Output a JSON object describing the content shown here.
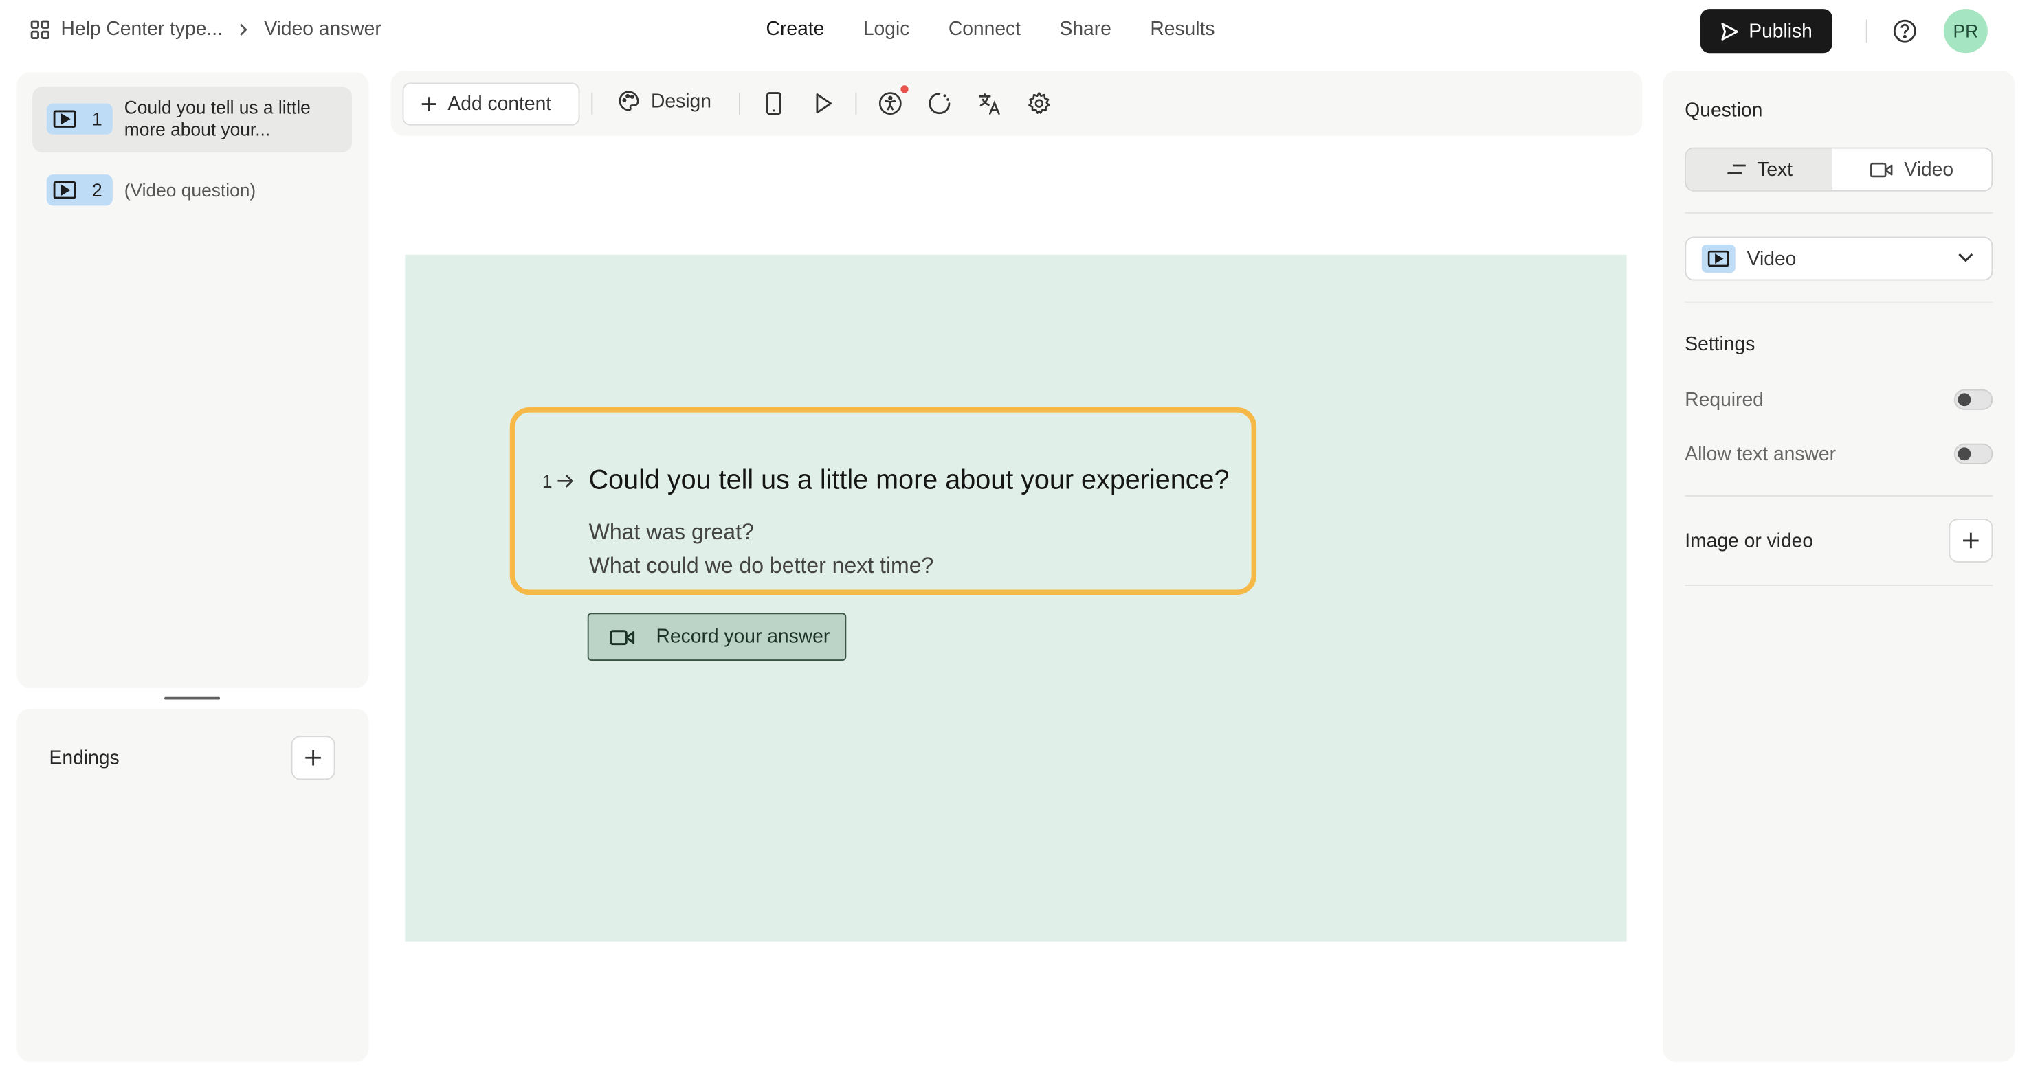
{
  "breadcrumb": {
    "form_name": "Help Center type...",
    "page": "Video answer"
  },
  "nav": {
    "create": "Create",
    "logic": "Logic",
    "connect": "Connect",
    "share": "Share",
    "results": "Results"
  },
  "header": {
    "publish_label": "Publish",
    "avatar_initials": "PR"
  },
  "questions": [
    {
      "number": "1",
      "label_line1": "Could you tell us a little",
      "label_line2": "more about your..."
    },
    {
      "number": "2",
      "label": "(Video question)"
    }
  ],
  "endings": {
    "title": "Endings"
  },
  "toolbar": {
    "add_content": "Add content",
    "design": "Design"
  },
  "canvas": {
    "question_number": "1",
    "question_title": "Could you tell us a little more about your experience?",
    "description_line1": "What was great?",
    "description_line2": "What could we do better next time?",
    "record_button": "Record your answer",
    "background_color": "#e0efe8",
    "highlight_color": "#f6b948"
  },
  "right_panel": {
    "question_title": "Question",
    "segment_text": "Text",
    "segment_video": "Video",
    "question_type": "Video",
    "settings_title": "Settings",
    "required_label": "Required",
    "allow_text_label": "Allow text answer",
    "media_title": "Image or video"
  },
  "colors": {
    "badge_blue": "#bfdcf7",
    "avatar_green": "#a6e5c2",
    "publish_bg": "#191919"
  }
}
